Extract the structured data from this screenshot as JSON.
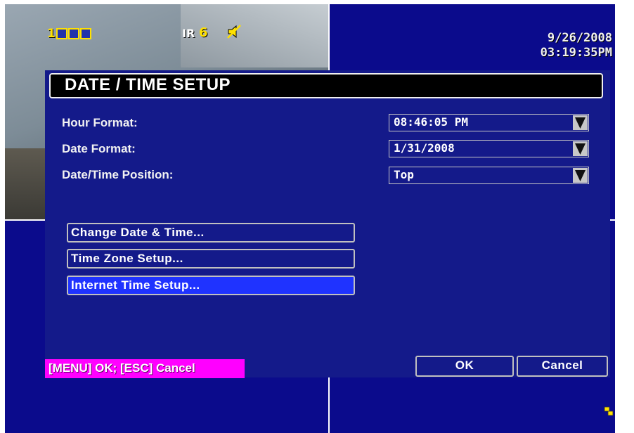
{
  "osd": {
    "camera_number": "1",
    "ir_label": "IR",
    "ir_value": "6",
    "date": "9/26/2008",
    "time": "03:19:35PM"
  },
  "dialog": {
    "title": "DATE / TIME SETUP",
    "fields": [
      {
        "label": "Hour Format:",
        "value": "08:46:05 PM"
      },
      {
        "label": "Date Format:",
        "value": "1/31/2008"
      },
      {
        "label": "Date/Time Position:",
        "value": "Top"
      }
    ],
    "actions": [
      {
        "label": "Change Date & Time..."
      },
      {
        "label": "Time Zone Setup..."
      },
      {
        "label": "Internet Time Setup..."
      }
    ],
    "hint": "[MENU] OK; [ESC] Cancel",
    "ok_label": "OK",
    "cancel_label": "Cancel"
  },
  "icons": {
    "camera_indicators": "square-icon",
    "mute": "speaker-mute-icon",
    "dropdown": "triangle-down-icon",
    "network": "network-icon"
  },
  "colors": {
    "background": "#0b0b8c",
    "dialog": "#141a8a",
    "highlight": "#1f33ff",
    "hint_bg": "#ff00ff",
    "osd_yellow": "#ffe100"
  }
}
